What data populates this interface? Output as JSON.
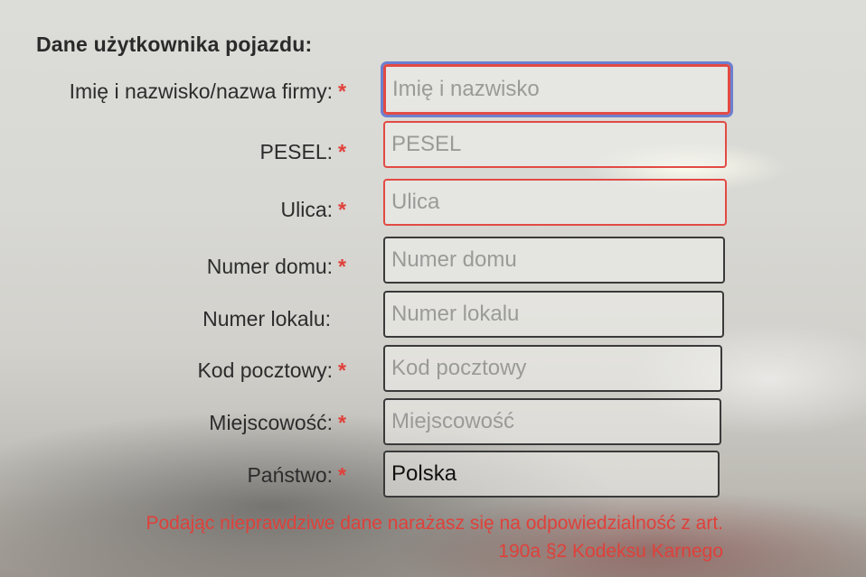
{
  "section": {
    "title": "Dane użytkownika pojazdu:"
  },
  "required_marker": "*",
  "fields": [
    {
      "label": "Imię i nazwisko/nazwa firmy:",
      "placeholder": "Imię i nazwisko",
      "value": "",
      "required": true,
      "state": "focused-invalid"
    },
    {
      "label": "PESEL:",
      "placeholder": "PESEL",
      "value": "",
      "required": true,
      "state": "invalid"
    },
    {
      "label": "Ulica:",
      "placeholder": "Ulica",
      "value": "",
      "required": true,
      "state": "invalid"
    },
    {
      "label": "Numer domu:",
      "placeholder": "Numer domu",
      "value": "",
      "required": true,
      "state": "normal"
    },
    {
      "label": "Numer lokalu:",
      "placeholder": "Numer lokalu",
      "value": "",
      "required": false,
      "state": "normal"
    },
    {
      "label": "Kod pocztowy:",
      "placeholder": "Kod pocztowy",
      "value": "",
      "required": true,
      "state": "normal"
    },
    {
      "label": "Miejscowość:",
      "placeholder": "Miejscowość",
      "value": "",
      "required": true,
      "state": "normal"
    },
    {
      "label": "Państwo:",
      "placeholder": "",
      "value": "Polska",
      "required": true,
      "state": "normal"
    }
  ],
  "warning": {
    "line1": "Podając nieprawdziwe dane narażasz się na odpowiedzialność z art.",
    "line2": "190a §2 Kodeksu Karnego"
  },
  "colors": {
    "required": "#e0403a",
    "invalid_border": "#e24a44",
    "focus_ring": "#6b7fcf",
    "warning_text": "#e0403a"
  }
}
